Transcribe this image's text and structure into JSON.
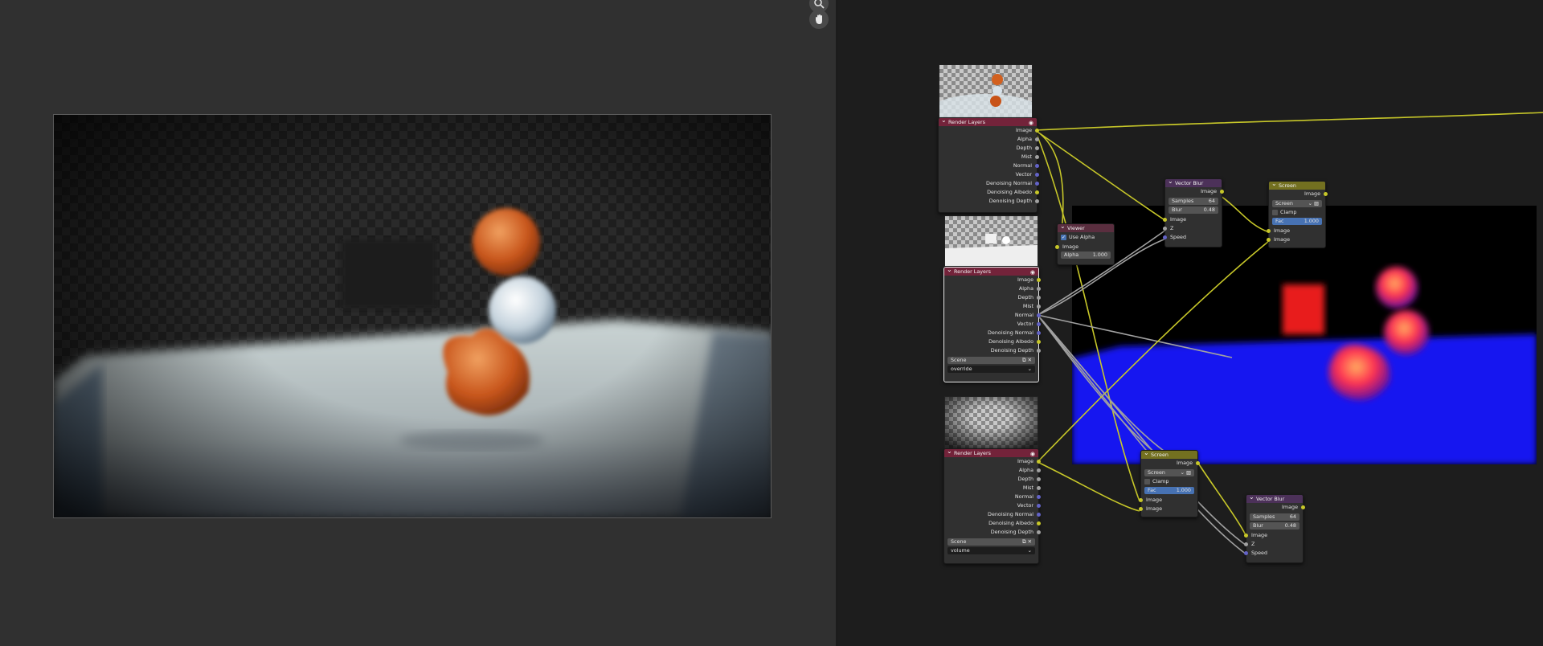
{
  "icons": {
    "zoom": "magnifier-icon",
    "pan": "hand-icon"
  },
  "colors": {
    "image_socket": "#c7c729",
    "float_socket": "#a1a1a1",
    "vector_socket": "#6363c7",
    "render_header": "#73233a",
    "mix_header": "#737020",
    "filter_header": "#4c3159",
    "selection": "#4772b3"
  },
  "nodes": {
    "render_layers_1": {
      "title": "Render Layers",
      "outputs": [
        "Image",
        "Alpha",
        "Depth",
        "Mist",
        "Normal",
        "Vector",
        "Denoising Normal",
        "Denoising Albedo",
        "Denoising Depth"
      ]
    },
    "render_layers_2": {
      "title": "Render Layers",
      "outputs": [
        "Image",
        "Alpha",
        "Depth",
        "Mist",
        "Normal",
        "Vector",
        "Denoising Normal",
        "Denoising Albedo",
        "Denoising Depth"
      ],
      "scene": "Scene",
      "layer": "override"
    },
    "render_layers_3": {
      "title": "Render Layers",
      "outputs": [
        "Image",
        "Alpha",
        "Depth",
        "Mist",
        "Normal",
        "Vector",
        "Denoising Normal",
        "Denoising Albedo",
        "Denoising Depth"
      ],
      "scene": "Scene",
      "layer": "volume"
    },
    "viewer": {
      "title": "Viewer",
      "use_alpha": "Use Alpha",
      "inputs": [
        "Image",
        "Alpha"
      ],
      "alpha_value": "1.000"
    },
    "vector_blur_1": {
      "title": "Vector Blur",
      "output": "Image",
      "samples_label": "Samples",
      "samples_value": "64",
      "blur_label": "Blur",
      "blur_value": "0.48",
      "inputs": [
        "Image",
        "Z",
        "Speed"
      ]
    },
    "vector_blur_2": {
      "title": "Vector Blur",
      "output": "Image",
      "samples_label": "Samples",
      "samples_value": "64",
      "blur_label": "Blur",
      "blur_value": "0.48",
      "inputs": [
        "Image",
        "Z",
        "Speed"
      ]
    },
    "screen_1": {
      "title": "Screen",
      "output": "Image",
      "blend": "Screen",
      "clamp": "Clamp",
      "fac_label": "Fac",
      "fac_value": "1.000",
      "inputs": [
        "Image",
        "Image"
      ]
    },
    "screen_2": {
      "title": "Screen",
      "output": "Image",
      "blend": "Screen",
      "clamp": "Clamp",
      "fac_label": "Fac",
      "fac_value": "1.000",
      "inputs": [
        "Image",
        "Image"
      ]
    }
  }
}
